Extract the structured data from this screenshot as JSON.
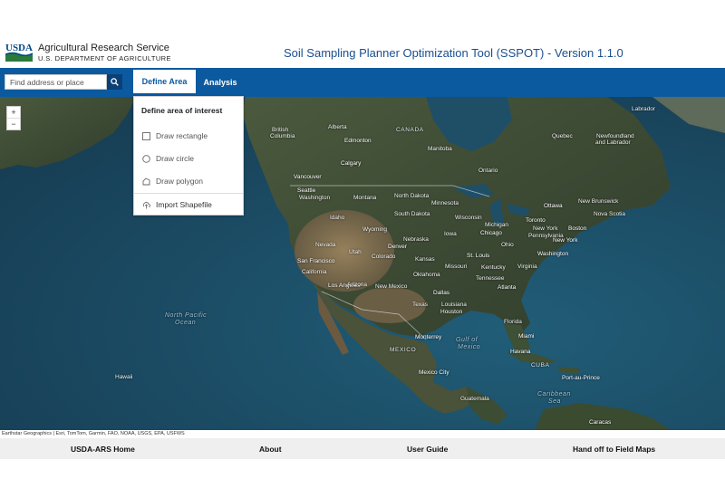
{
  "header": {
    "logo_text": "USDA",
    "org_name": "Agricultural Research Service",
    "org_dept": "U.S. DEPARTMENT OF AGRICULTURE",
    "app_title": "Soil Sampling Planner Optimization Tool (SSPOT) - Version 1.1.0"
  },
  "navbar": {
    "search_placeholder": "Find address or place",
    "search_icon": "search-icon",
    "tabs": [
      {
        "label": "Define Area",
        "active": true
      },
      {
        "label": "Analysis",
        "active": false
      }
    ],
    "accent_color": "#0b5aa0"
  },
  "dropdown": {
    "title": "Define area of interest",
    "items": [
      {
        "label": "Draw rectangle",
        "icon": "square-icon"
      },
      {
        "label": "Draw circle",
        "icon": "circle-icon"
      },
      {
        "label": "Draw polygon",
        "icon": "polygon-icon"
      },
      {
        "label": "Import Shapefile",
        "icon": "upload-icon"
      }
    ]
  },
  "map": {
    "zoom_in": "+",
    "zoom_out": "−",
    "attribution": "Earthstar Geographics | Esri, TomTom, Garmin, FAO, NOAA, USGS, EPA, USFWS",
    "labels": {
      "canada": "CANADA",
      "north_pacific": "North Pacific",
      "ocean": "Ocean",
      "mexico": "MEXICO",
      "gulf_of": "Gulf of",
      "gulf_mexico": "Mexico",
      "cuba": "CUBA",
      "caribbean": "Caribbean",
      "sea": "Sea",
      "alberta": "Alberta",
      "british": "British",
      "columbia": "Columbia",
      "edmonton": "Edmonton",
      "calgary": "Calgary",
      "manitoba": "Manitoba",
      "ontario": "Ontario",
      "quebec": "Quebec",
      "labrador": "Labrador",
      "nl1": "Newfoundland",
      "nl2": "and Labrador",
      "vancouver": "Vancouver",
      "seattle": "Seattle",
      "washington_st": "Washington",
      "montana": "Montana",
      "idaho": "Idaho",
      "wyoming": "Wyoming",
      "north_dakota": "North Dakota",
      "south_dakota": "South Dakota",
      "minnesota": "Minnesota",
      "wisconsin": "Wisconsin",
      "michigan": "Michigan",
      "nebraska": "Nebraska",
      "iowa": "Iowa",
      "chicago": "Chicago",
      "ohio": "Ohio",
      "pennsylvania": "Pennsylvania",
      "toronto": "Toronto",
      "ottawa": "Ottawa",
      "new_york_st": "New York",
      "new_york": "New York",
      "boston": "Boston",
      "new_brunswick": "New Brunswick",
      "nova_scotia": "Nova Scotia",
      "denver": "Denver",
      "colorado": "Colorado",
      "kansas": "Kansas",
      "missouri": "Missouri",
      "st_louis": "St. Louis",
      "kentucky": "Kentucky",
      "virginia": "Virginia",
      "washington_dc": "Washington",
      "san_francisco": "San Francisco",
      "california": "California",
      "los_angeles": "Los Angeles",
      "nevada": "Nevada",
      "utah": "Utah",
      "arizona": "Arizona",
      "new_mexico": "New Mexico",
      "oklahoma": "Oklahoma",
      "dallas": "Dallas",
      "texas": "Texas",
      "houston": "Houston",
      "louisiana": "Louisiana",
      "atlanta": "Atlanta",
      "tennessee": "Tennessee",
      "florida": "Florida",
      "monterrey": "Monterrey",
      "mexico_city": "Mexico City",
      "miami": "Miami",
      "havana": "Havana",
      "guatemala": "Guatemala",
      "port_au_prince": "Port-au-Prince",
      "caracas": "Caracas",
      "hawaii": "Hawaii"
    }
  },
  "footer": {
    "links": [
      "USDA-ARS Home",
      "About",
      "User Guide",
      "Hand off to Field Maps"
    ]
  }
}
